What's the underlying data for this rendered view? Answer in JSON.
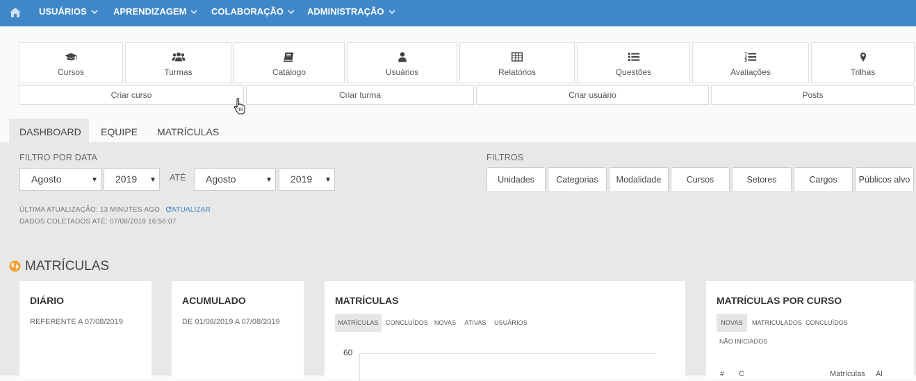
{
  "nav": {
    "items": [
      {
        "label": "USUÁRIOS"
      },
      {
        "label": "APRENDIZAGEM"
      },
      {
        "label": "COLABORAÇÃO"
      },
      {
        "label": "ADMINISTRAÇÃO"
      }
    ]
  },
  "shortcuts": [
    {
      "label": "Cursos",
      "icon": "graduation-cap-icon"
    },
    {
      "label": "Turmas",
      "icon": "users-group-icon"
    },
    {
      "label": "Catálogo",
      "icon": "book-icon"
    },
    {
      "label": "Usuários",
      "icon": "user-icon"
    },
    {
      "label": "Relatórios",
      "icon": "table-icon"
    },
    {
      "label": "Questões",
      "icon": "list-icon"
    },
    {
      "label": "Avaliações",
      "icon": "ordered-list-icon"
    },
    {
      "label": "Trilhas",
      "icon": "map-marker-icon"
    }
  ],
  "actions": [
    {
      "label": "Criar curso"
    },
    {
      "label": "Criar turma"
    },
    {
      "label": "Criar usuário"
    },
    {
      "label": "Posts"
    }
  ],
  "tabs": [
    {
      "label": "DASHBOARD"
    },
    {
      "label": "EQUIPE"
    },
    {
      "label": "MATRÍCULAS"
    }
  ],
  "date_filter": {
    "label": "FILTRO POR DATA",
    "from_month": "Agosto",
    "from_year": "2019",
    "until": "ATÉ",
    "to_month": "Agosto",
    "to_year": "2019"
  },
  "filters": {
    "label": "FILTROS",
    "buttons": [
      {
        "label": "Unidades"
      },
      {
        "label": "Categorias"
      },
      {
        "label": "Modalidade"
      },
      {
        "label": "Cursos"
      },
      {
        "label": "Setores"
      },
      {
        "label": "Cargos"
      },
      {
        "label": "Públicos alvo"
      }
    ]
  },
  "meta": {
    "last_update": "ÚLTIMA ATUALIZAÇÃO: 13 MINUTES AGO",
    "refresh": "ATUALIZAR",
    "collected": "DADOS COLETADOS ATÉ: 07/08/2019 16:56:07"
  },
  "section": {
    "title": "MATRÍCULAS"
  },
  "cards": {
    "diario": {
      "title": "DIÁRIO",
      "sub": "REFERENTE A 07/08/2019"
    },
    "acumulado": {
      "title": "ACUMULADO",
      "sub": "DE 01/08/2019 A 07/08/2019"
    },
    "matriculas": {
      "title": "MATRÍCULAS",
      "chips": [
        "MATRÍCULAS",
        "CONCLUÍDOS",
        "NOVAS",
        "ATIVAS",
        "USUÁRIOS"
      ],
      "y_tick": "60"
    },
    "por_curso": {
      "title": "MATRÍCULAS POR CURSO",
      "chips": [
        "NOVAS",
        "MATRICULADOS",
        "CONCLUÍDOS",
        "NÃO INICIADOS"
      ],
      "col_hash": "#",
      "col_curso": "C",
      "col_matriculas": "Matrículas",
      "col_al": "Al"
    }
  },
  "colors": {
    "nav_bg": "#3e87c8",
    "accent": "#3e87c8",
    "globe": "#f0a030"
  }
}
